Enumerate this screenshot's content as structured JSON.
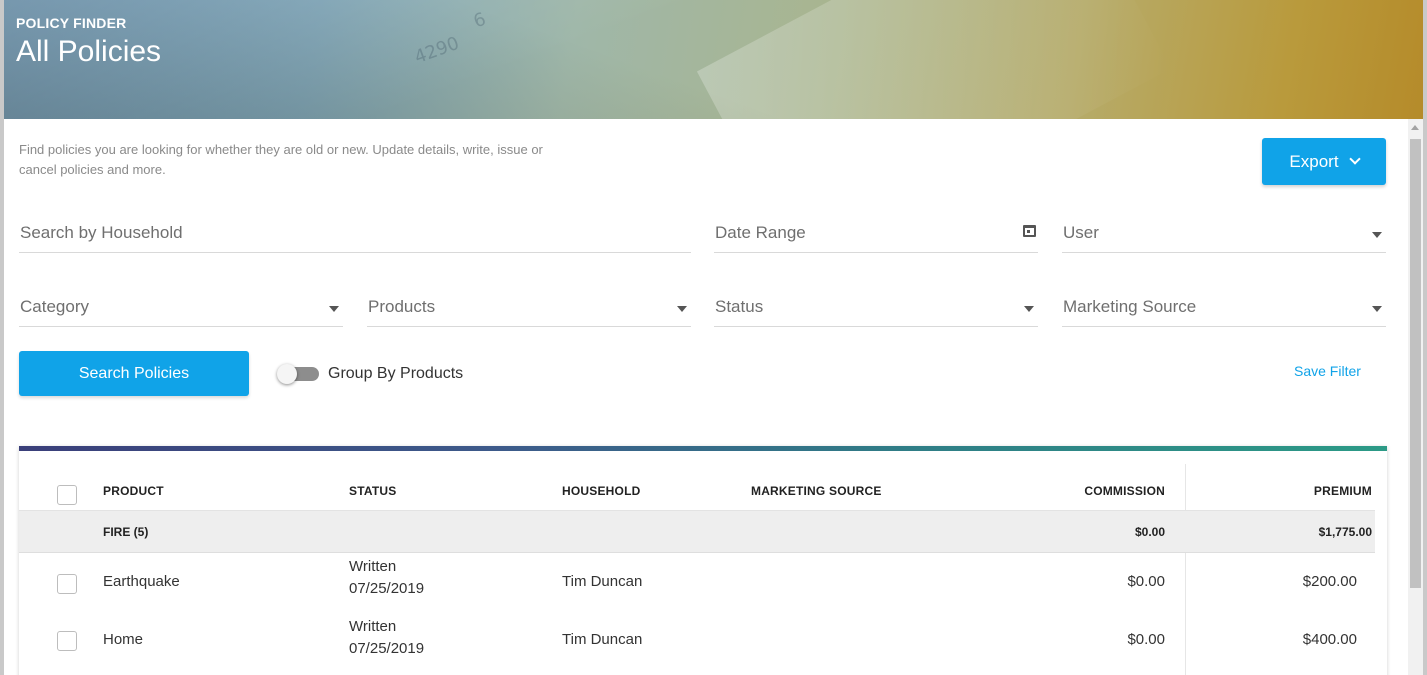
{
  "hero": {
    "eyebrow": "POLICY FINDER",
    "title": "All Policies",
    "decor": [
      "4290",
      "6"
    ]
  },
  "intro": {
    "description": "Find policies you are looking for whether they are old or new. Update details, write, issue or cancel policies and more."
  },
  "toolbar": {
    "export_label": "Export",
    "export_icon": "chevron-down-icon"
  },
  "filters": {
    "household_placeholder": "Search by Household",
    "date_range_placeholder": "Date Range",
    "date_range_icon": "calendar-icon",
    "user_placeholder": "User",
    "category_placeholder": "Category",
    "products_placeholder": "Products",
    "status_placeholder": "Status",
    "marketing_source_placeholder": "Marketing Source"
  },
  "actions": {
    "search_label": "Search Policies",
    "group_by_label": "Group By Products",
    "group_by_on": false,
    "save_filter_label": "Save Filter"
  },
  "table": {
    "columns": {
      "product": "PRODUCT",
      "status": "STATUS",
      "household": "HOUSEHOLD",
      "marketing_source": "MARKETING SOURCE",
      "commission": "COMMISSION",
      "premium": "PREMIUM"
    },
    "group": {
      "label": "FIRE (5)",
      "commission": "$0.00",
      "premium": "$1,775.00"
    },
    "rows": [
      {
        "product": "Earthquake",
        "status": "Written",
        "date": "07/25/2019",
        "household": "Tim Duncan",
        "marketing_source": "",
        "commission": "$0.00",
        "premium": "$200.00"
      },
      {
        "product": "Home",
        "status": "Written",
        "date": "07/25/2019",
        "household": "Tim Duncan",
        "marketing_source": "",
        "commission": "$0.00",
        "premium": "$400.00"
      }
    ]
  },
  "colors": {
    "accent": "#10a3e8",
    "card_top_start": "#3a3f7a",
    "card_top_end": "#2c9a86"
  }
}
